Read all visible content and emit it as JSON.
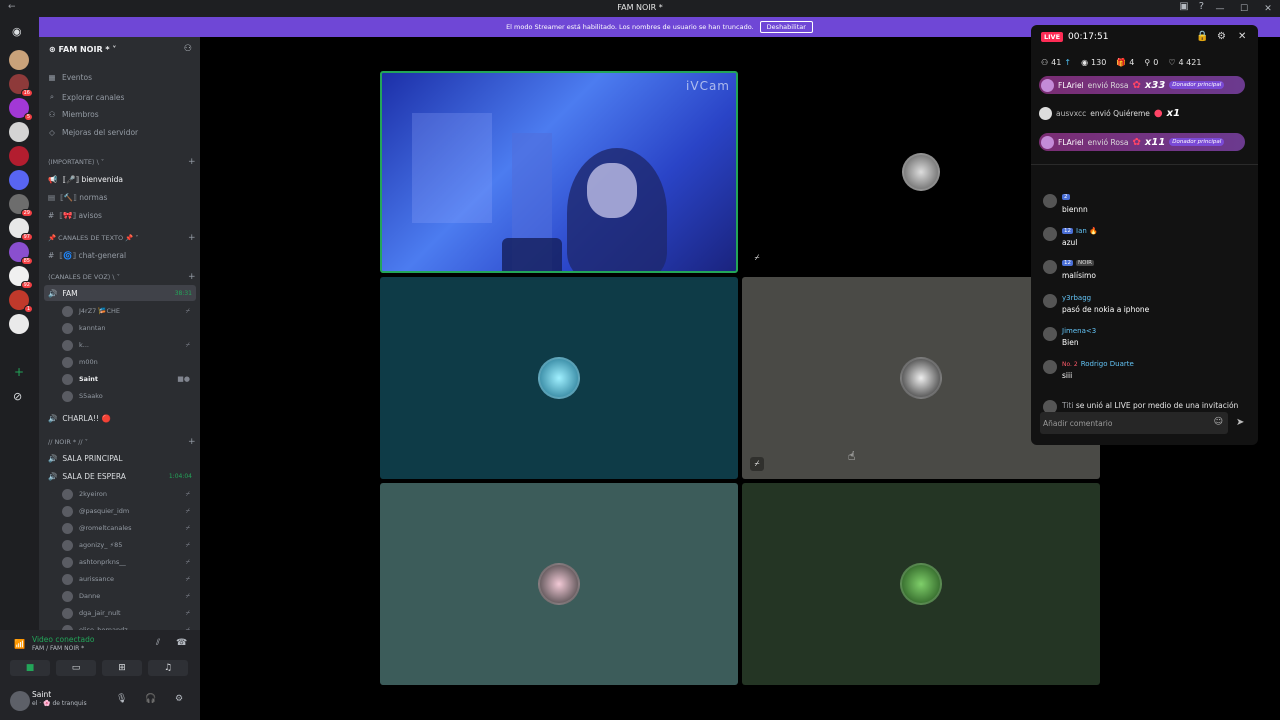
{
  "window": {
    "title": "FAM NOIR *"
  },
  "streamer_bar": {
    "text": "El modo Streamer está habilitado. Los nombres de usuario se han truncado.",
    "button": "Deshabilitar"
  },
  "servers": [
    {
      "color": "#c9a27a",
      "badge": ""
    },
    {
      "color": "#8e3a3a",
      "badge": "16"
    },
    {
      "color": "#a238d6",
      "badge": "5"
    },
    {
      "color": "#d4d4d4",
      "badge": ""
    },
    {
      "color": "#b31d2f",
      "badge": ""
    },
    {
      "color": "#5865f2",
      "badge": ""
    },
    {
      "color": "#6d6d6d",
      "badge": "29"
    },
    {
      "color": "#e8e8e8",
      "badge": "97"
    },
    {
      "color": "#8a4fcf",
      "badge": "85"
    },
    {
      "color": "#f0f0f0",
      "badge": "92"
    },
    {
      "color": "#c0392b",
      "badge": "1"
    },
    {
      "color": "#eaeaea",
      "badge": ""
    }
  ],
  "guild": {
    "name": "FAM NOIR *"
  },
  "nav": [
    "Eventos",
    "Explorar canales",
    "Miembros",
    "Mejoras del servidor"
  ],
  "categories": {
    "importante": "⟨IMPORTANTE⟩ \\",
    "texto": "📌 CANALES DE TEXTO 📌",
    "voz": "⟨CANALES DE VOZ⟩ \\",
    "noir": "// NOIR * //"
  },
  "channels": {
    "bienvenida": "⟦🎤⟧ bienvenida",
    "normas": "⟦🔨⟧ normas",
    "avisos": "⟦🎀⟧ avisos",
    "chat_general": "⟦🌀⟧ chat-general",
    "fam": "FAM",
    "fam_timer": "38:31",
    "charla": "CHARLA!! 🔴",
    "sala_principal": "SALA PRINCIPAL",
    "sala_espera": "SALA DE ESPERA",
    "sala_espera_timer": "1:04:04"
  },
  "fam_users": [
    "J4rZ7 🎏CHE",
    "kanntan",
    "k...",
    "m00n",
    "Saint",
    "S5aako"
  ],
  "espera_users": [
    "2kyeiron",
    "@pasquier_idm",
    "@romeltcanales",
    "agonizy_ ⚡85",
    "ashtonprkns__",
    "aurissance",
    "Danne",
    "dga_jair_nult",
    "elise_hernandz"
  ],
  "voice_panel": {
    "status": "Video conectado",
    "location": "FAM / FAM NOIR *"
  },
  "user_panel": {
    "name": "Saint",
    "status": "el · 🌸 de tranquis"
  },
  "video": {
    "cam_tag": "iVCam"
  },
  "live": {
    "badge": "LIVE",
    "time": "00:17:51",
    "stats": {
      "viewers": "41",
      "views": "130",
      "gifts": "4",
      "shares": "0",
      "likes": "4 421"
    },
    "gifts": [
      {
        "user": "FLAriel",
        "action": "envió Rosa",
        "mult": "x33",
        "tag": "Donador principal",
        "pill": true
      },
      {
        "user": "ausvxcc",
        "action": "envió Quiéreme",
        "mult": "x1",
        "tag": "",
        "pill": false
      },
      {
        "user": "FLAriel",
        "action": "envió Rosa",
        "mult": "x11",
        "tag": "Donador principal",
        "pill": true
      }
    ],
    "messages": [
      {
        "user": "",
        "level": "2",
        "extra": "",
        "text": "biennn"
      },
      {
        "user": "Ian 🔥",
        "level": "12",
        "extra": "",
        "text": "azul"
      },
      {
        "user": "",
        "level": "12",
        "extra": "NOIR",
        "text": "malísimo"
      },
      {
        "user": "y3rbagg",
        "level": "",
        "extra": "",
        "text": "pasó de nokia a iphone"
      },
      {
        "user": "Jimena<3",
        "level": "",
        "extra": "",
        "text": "Bien"
      },
      {
        "user": "Rodrigo Duarte",
        "level": "",
        "extra": "No. 2",
        "text": "siii"
      }
    ],
    "join": {
      "user": "Titi",
      "text": "se unió al LIVE por medio de una invitación compartida"
    },
    "comment_placeholder": "Añadir comentario"
  }
}
